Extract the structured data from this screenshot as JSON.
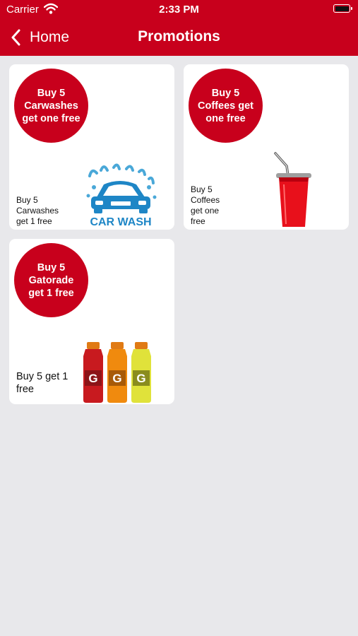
{
  "status_bar": {
    "carrier": "Carrier",
    "time": "2:33 PM"
  },
  "nav": {
    "back_label": "Home",
    "title": "Promotions"
  },
  "promotions": [
    {
      "badge": "Buy 5 Carwashes get one free",
      "caption": "Buy 5 Carwashes get 1 free",
      "image_text": "CAR WASH",
      "icon": "car-wash-image"
    },
    {
      "badge": "Buy 5 Coffees get one free",
      "caption": "Buy 5 Coffees get one free",
      "icon": "coffee-cup-image"
    },
    {
      "badge": "Buy 5 Gatorade get 1 free",
      "caption": "Buy 5 get 1 free",
      "icon": "gatorade-bottles-image"
    }
  ],
  "colors": {
    "brand": "#c8001c",
    "background": "#e8e8eb",
    "card": "#ffffff"
  }
}
